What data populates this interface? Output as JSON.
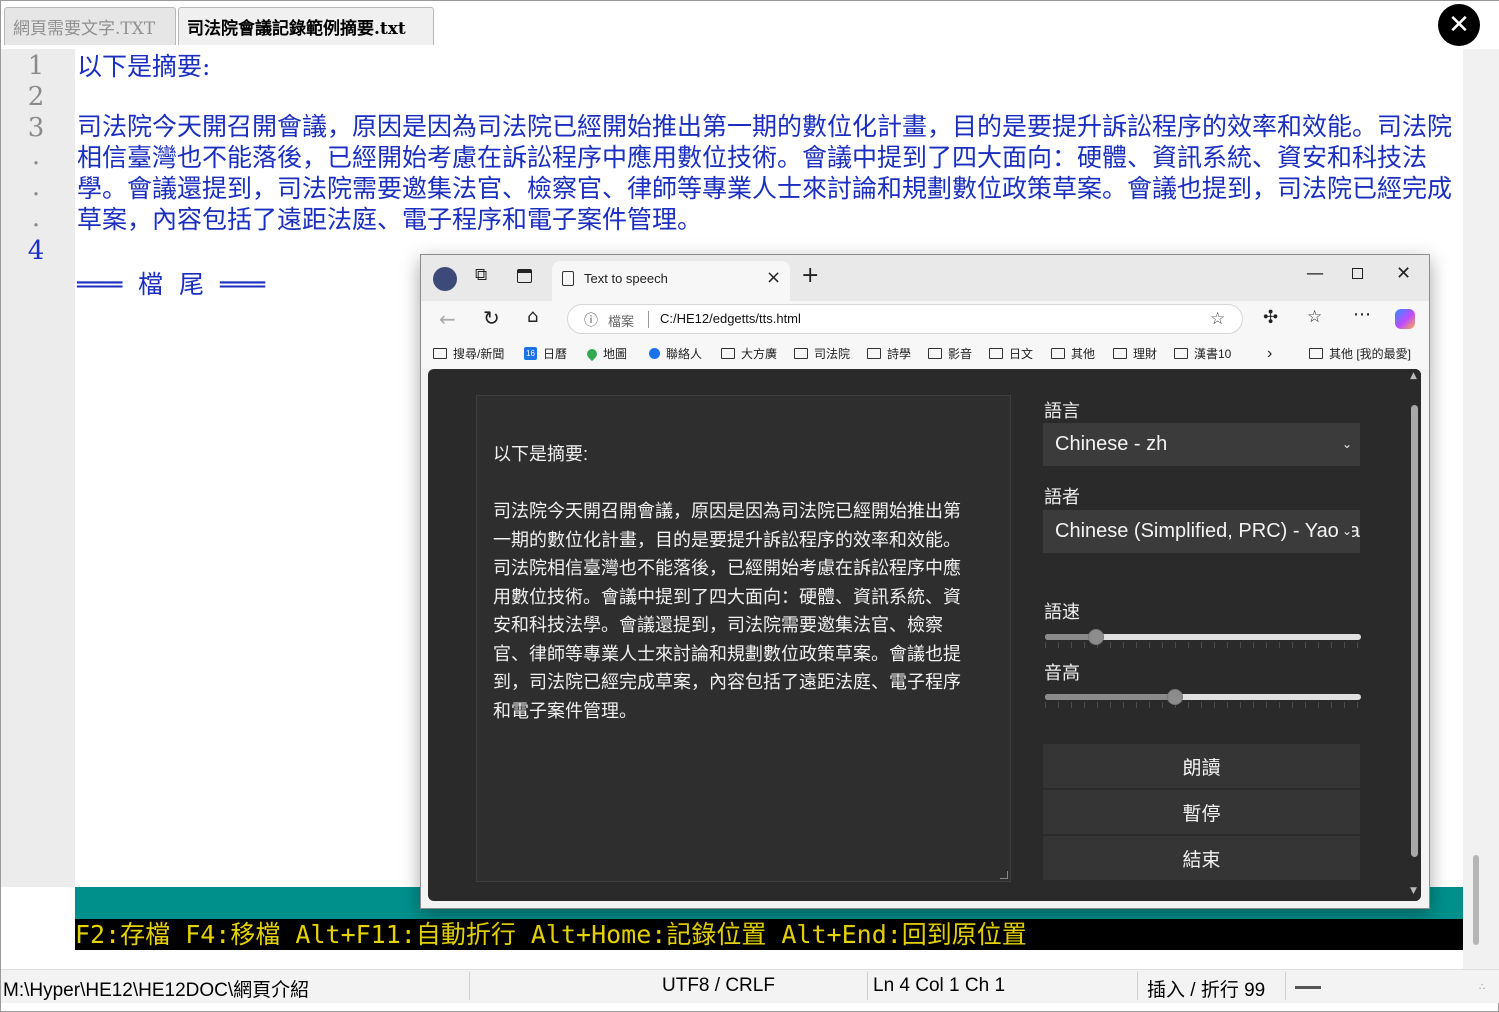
{
  "editor": {
    "tabs": [
      {
        "label": "網頁需要文字.TXT",
        "active": false
      },
      {
        "label": "司法院會議記錄範例摘要.txt",
        "active": true
      }
    ],
    "line_numbers": [
      "1",
      "2",
      "3",
      ".",
      ".",
      ".",
      "4"
    ],
    "lines": {
      "l1": "以下是摘要:",
      "l3": "司法院今天開召開會議，原因是因為司法院已經開始推出第一期的數位化計畫，目的是要提升訴訟程序的效率和效能。司法院相信臺灣也不能落後，已經開始考慮在訴訟程序中應用數位技術。會議中提到了四大面向：硬體、資訊系統、資安和科技法學。會議還提到，司法院需要邀集法官、檢察官、律師等專業人士來討論和規劃數位政策草案。會議也提到，司法院已經完成草案，內容包括了遠距法庭、電子程序和電子案件管理。",
      "eof": "═══  檔  尾  ═══"
    },
    "keybar": "F2:存檔 F4:移檔 Alt+F11:自動折行 Alt+Home:記錄位置 Alt+End:回到原位置",
    "status": {
      "path": "M:\\Hyper\\HE12\\HE12DOC\\網頁介紹",
      "encoding": "UTF8 / CRLF",
      "position": "Ln 4  Col 1  Ch 1",
      "mode": "插入 / 折行 99"
    },
    "close_label": "✕"
  },
  "browser": {
    "tab_title": "Text to speech",
    "address_label": "檔案",
    "address_url": "C:/HE12/edgetts/tts.html",
    "favorites": [
      "搜尋/新聞",
      "日曆",
      "地圖",
      "聯絡人",
      "大方廣",
      "司法院",
      "詩學",
      "影音",
      "日文",
      "其他",
      "理財",
      "漢書10",
      "其他 [我的最愛]"
    ],
    "calendar_badge": "16"
  },
  "tts": {
    "text_lines": {
      "intro": "以下是摘要:",
      "body": [
        "司法院今天開召開會議，原因是因為司法院已經開始推出第",
        "一期的數位化計畫，目的是要提升訴訟程序的效率和效能。",
        "司法院相信臺灣也不能落後，已經開始考慮在訴訟程序中應",
        "用數位技術。會議中提到了四大面向：硬體、資訊系統、資",
        "安和科技法學。會議還提到，司法院需要邀集法官、檢察",
        "官、律師等專業人士來討論和規劃數位政策草案。會議也提",
        "到，司法院已經完成草案，內容包括了遠距法庭、電子程序",
        "和電子案件管理。"
      ]
    },
    "language_label": "語言",
    "language_value": "Chinese - zh",
    "voice_label": "語者",
    "voice_value": "Chinese (Simplified, PRC) - Yaoyao",
    "rate_label": "語速",
    "rate_value": 0.16,
    "pitch_label": "音高",
    "pitch_value": 0.41,
    "buttons": {
      "read": "朗讀",
      "pause": "暫停",
      "stop": "結束"
    }
  },
  "colors": {
    "editor_text": "#1a2fbf",
    "teal_bar": "#00908c",
    "keybar_text": "#e6d200"
  }
}
